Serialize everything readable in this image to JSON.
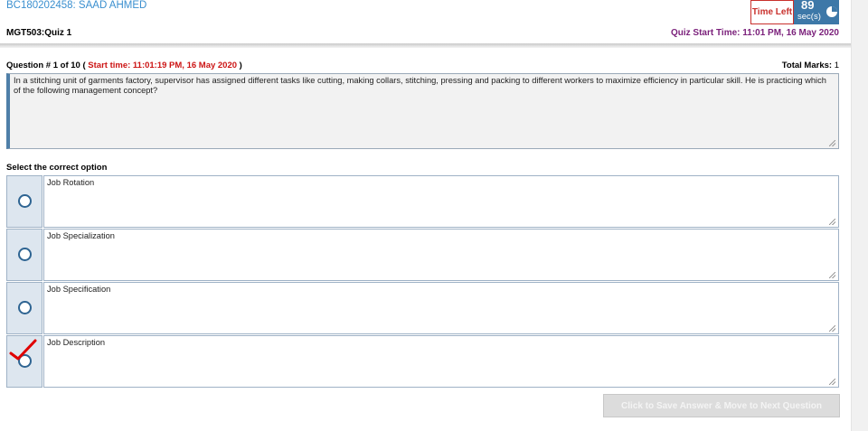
{
  "student": {
    "id_name": "BC180202458: SAAD AHMED"
  },
  "quiz": {
    "name": "MGT503:Quiz 1",
    "start_time_label": "Quiz Start Time: 11:01 PM, 16 May 2020"
  },
  "timer": {
    "label": "Time Left",
    "value": "89",
    "unit": "sec(s)"
  },
  "question": {
    "header_prefix": "Question # 1 of 10 (",
    "start_time": " Start time: 11:01:19 PM, 16 May 2020 ",
    "header_suffix": ")",
    "total_marks_label": "Total Marks:",
    "total_marks_value": " 1",
    "text": "In a stitching unit of garments factory, supervisor has assigned different tasks like cutting, making collars, stitching, pressing and packing to different workers to maximize efficiency in particular skill. He is practicing which of the following management concept?"
  },
  "options": {
    "label": "Select the correct option",
    "items": [
      {
        "text": "Job Rotation"
      },
      {
        "text": "Job Specialization"
      },
      {
        "text": "Job Specification"
      },
      {
        "text": "Job Description"
      }
    ]
  },
  "actions": {
    "save_next": "Click to Save Answer & Move to Next Question"
  },
  "colors": {
    "accent": "#3d78a8",
    "alert": "#cc1414",
    "purple": "#7a1f7a"
  }
}
